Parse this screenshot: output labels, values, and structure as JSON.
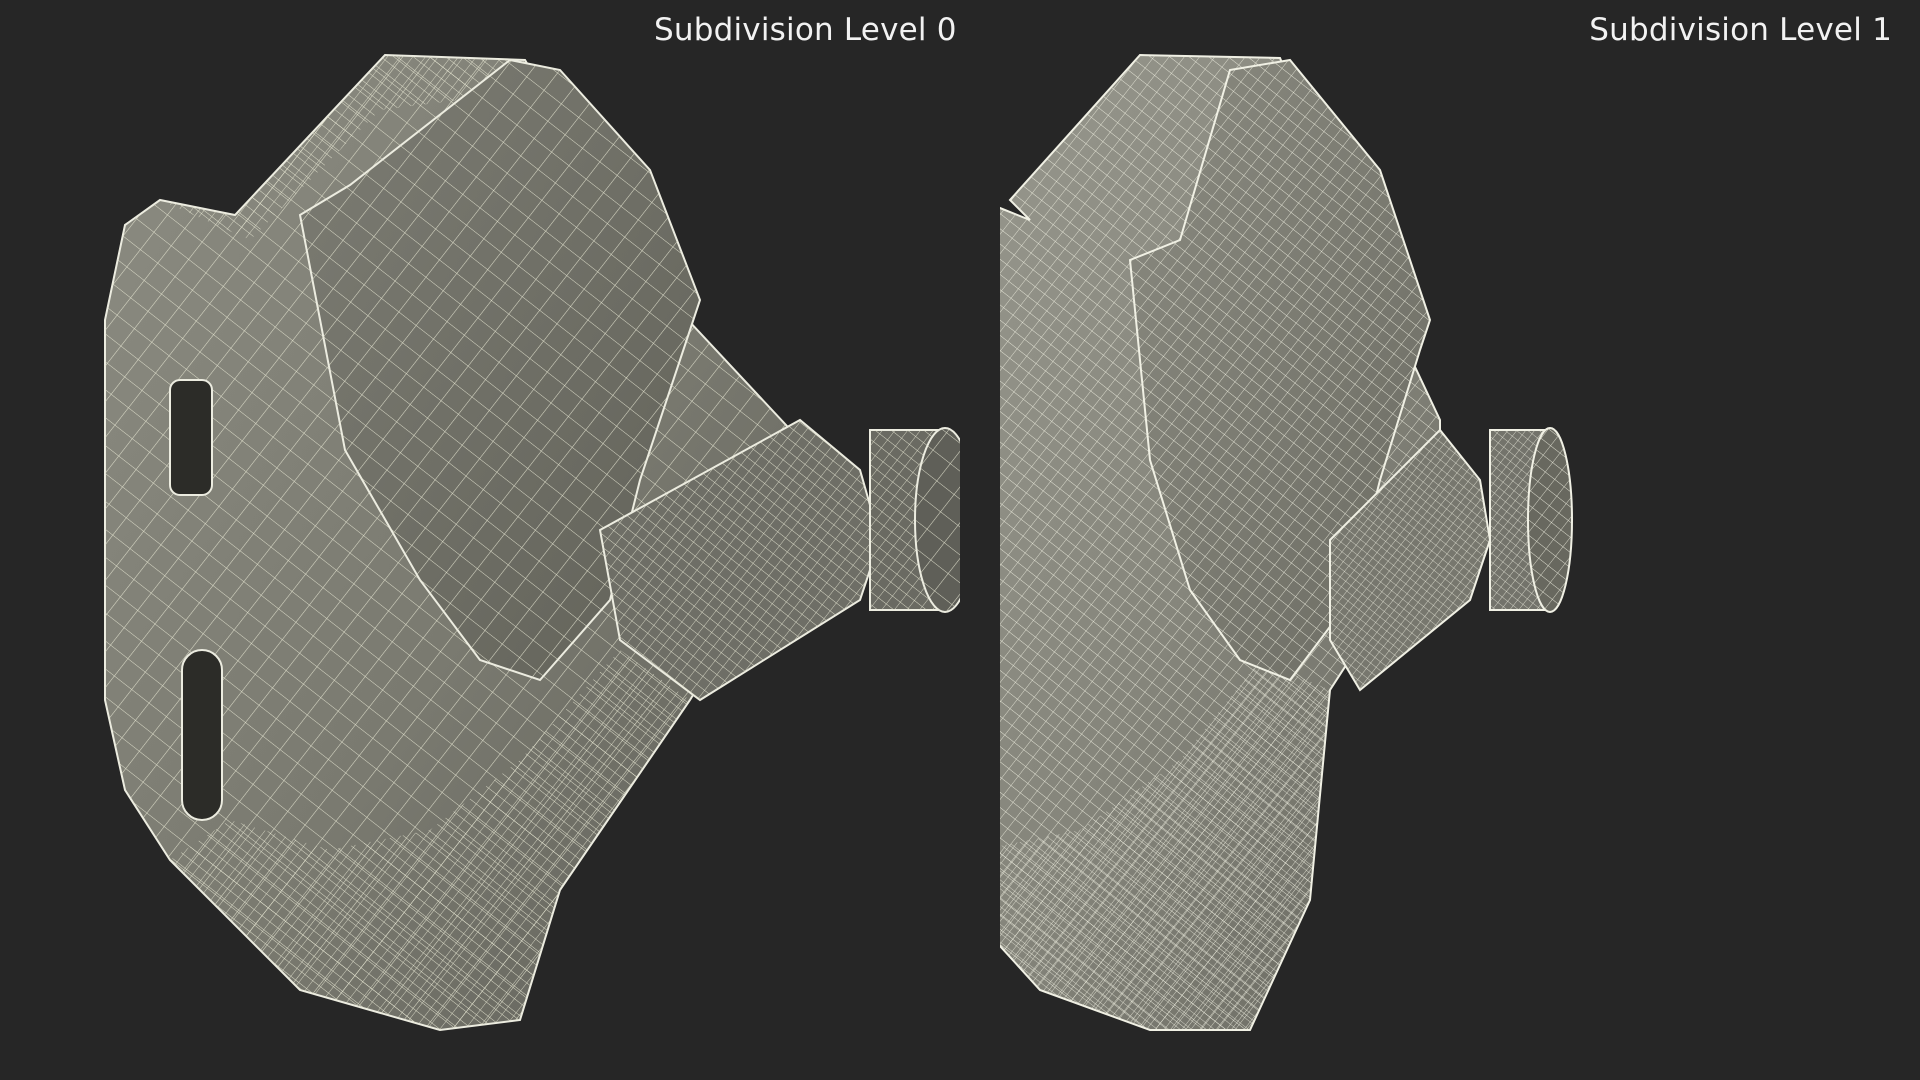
{
  "captions": {
    "left": "Subdivision Level 0",
    "right": "Subdivision Level 1"
  },
  "renders": [
    {
      "subdivision_level": 0
    },
    {
      "subdivision_level": 1
    }
  ],
  "colors": {
    "background": "#262626",
    "body_fill_light": "#8e8e84",
    "body_fill_dark": "#5d5d56",
    "wireframe": "#e8e8d6",
    "caption": "#f2f2f2"
  }
}
